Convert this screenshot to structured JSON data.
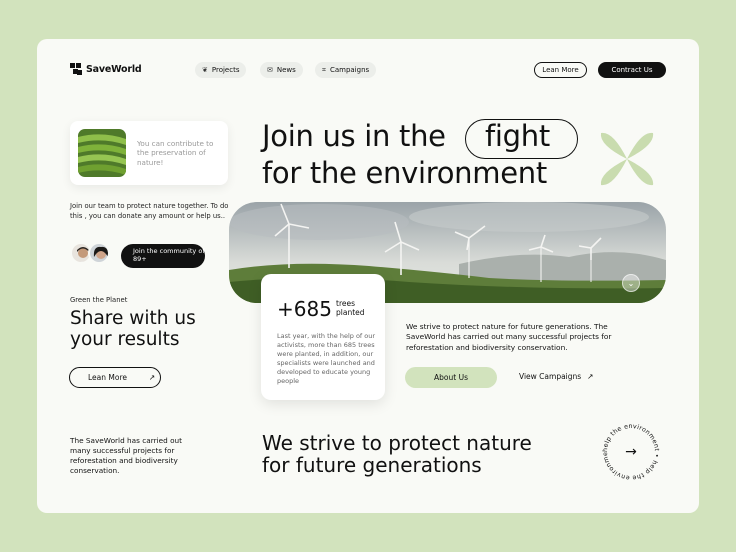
{
  "logo": {
    "text": "SaveWorld"
  },
  "nav": [
    {
      "label": "Projects",
      "icon": "leaf-icon"
    },
    {
      "label": "News",
      "icon": "mail-icon"
    },
    {
      "label": "Campaigns",
      "icon": "chart-icon"
    }
  ],
  "header": {
    "learn_more": "Lean More",
    "contract_us": "Contract Us"
  },
  "contribute": {
    "text": "You can contribute to the preservation of nature!"
  },
  "join": {
    "text": "Join our team to protect nature together. To do this , you can donate any amount or help us..",
    "community_button": "Join the community of 89+"
  },
  "share": {
    "eyebrow": "Green the Planet",
    "title_line1": "Share with us",
    "title_line2": "your results",
    "button": "Lean More"
  },
  "bottom_left": "The SaveWorld has carried out many successful projects for reforestation and biodiversity conservation.",
  "headline": {
    "line1": "Join us in the",
    "highlight": "fight",
    "line2": "for the environment"
  },
  "stats": {
    "number": "+685",
    "label_line1": "trees",
    "label_line2": "planted",
    "body": "Last year, with the help of our activists, more than 685 trees were planted, in addition, our specialists were launched and developed to educate young people"
  },
  "strive_small": "We strive to protect nature for future generations. The SaveWorld has carried out many successful projects for reforestation and biodiversity conservation.",
  "buttons": {
    "about": "About Us",
    "view_campaigns": "View Campaigns"
  },
  "strive_big": {
    "line1": "We strive to protect nature",
    "line2": "for future generations"
  },
  "badge": {
    "ring_text": "help the environment • help the environment •",
    "arrow": "→"
  },
  "colors": {
    "accent": "#d2e3bd",
    "dark": "#111111",
    "card": "#f9faf6"
  }
}
